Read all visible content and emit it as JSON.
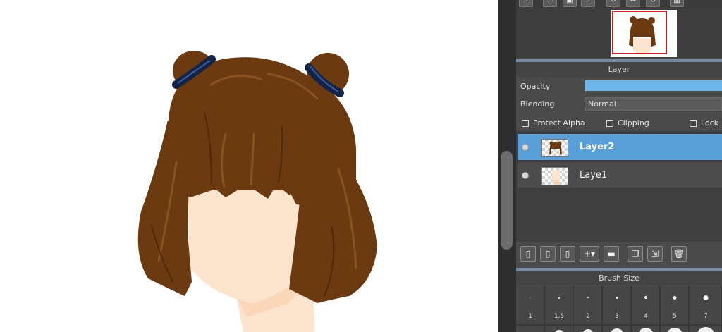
{
  "canvas": {
    "description_colors": {
      "hair": "#6b3a10",
      "skin": "#fde4cf",
      "neck": "#fbd7ba",
      "hair_tie": "#142447"
    }
  },
  "navigator": {
    "toolbar_icons": [
      "zoom-in-icon",
      "zoom-out-icon",
      "fit-icon",
      "zoom-icon",
      "rotate-left-icon",
      "flip-icon",
      "rotate-right-icon",
      "panel-icon"
    ]
  },
  "layer_panel": {
    "title": "Layer",
    "opacity_label": "Opacity",
    "opacity_value": 1.0,
    "blending_label": "Blending",
    "blending_value": "Normal",
    "protect_alpha_label": "Protect Alpha",
    "clipping_label": "Clipping",
    "lock_label": "Lock",
    "layers": [
      {
        "name": "Layer2",
        "selected": true
      },
      {
        "name": "Laye1",
        "selected": false
      }
    ],
    "tool_icons": [
      "new-layer-icon",
      "new-layer-8bit-icon",
      "new-layer-1bit-icon",
      "add-layer-menu-icon",
      "folder-icon",
      "duplicate-icon",
      "merge-down-icon",
      "delete-icon"
    ]
  },
  "brush_size": {
    "title": "Brush Size",
    "sizes": [
      "1",
      "1.5",
      "2",
      "3",
      "4",
      "5",
      "7"
    ]
  },
  "colors": {
    "panel_bg": "#4a4a4a",
    "selected_layer": "#5b9fd8",
    "opacity_fill": "#6fb6ea",
    "nav_frame": "#c8242a"
  }
}
